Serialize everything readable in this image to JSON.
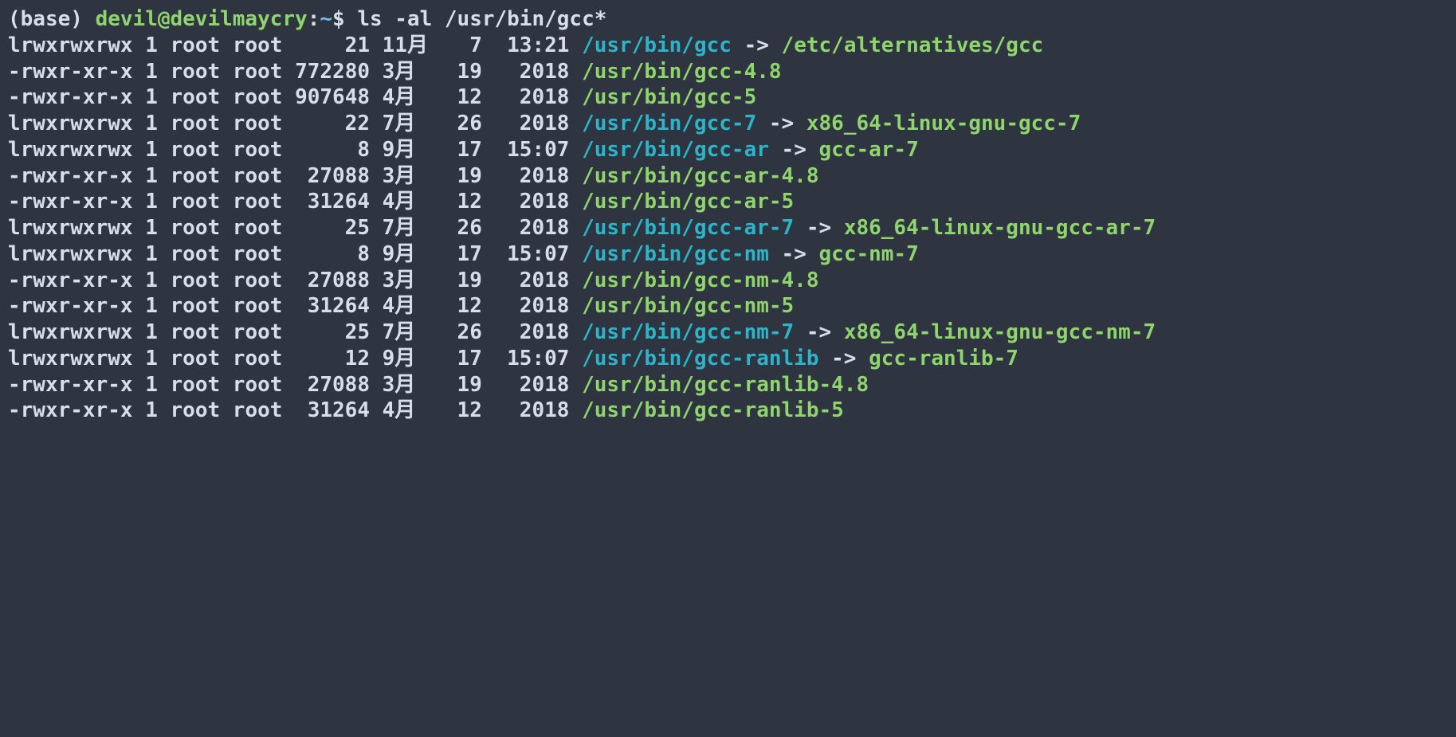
{
  "prompt": {
    "env": "(base) ",
    "user_host": "devil@devilmaycry",
    "colon": ":",
    "cwd": "~",
    "dollar": "$ ",
    "command": "ls -al /usr/bin/gcc*"
  },
  "rows": [
    {
      "perms": "lrwxrwxrwx",
      "n": "1",
      "owner": "root",
      "group": "root",
      "size": "21",
      "month": "11月",
      "day": "7",
      "time": "13:21",
      "name": "/usr/bin/gcc",
      "kind": "symlink",
      "arrow": " -> ",
      "target": "/etc/alternatives/gcc",
      "target_kind": "exec"
    },
    {
      "perms": "-rwxr-xr-x",
      "n": "1",
      "owner": "root",
      "group": "root",
      "size": "772280",
      "month": "3月",
      "day": "19",
      "time": "2018",
      "name": "/usr/bin/gcc-4.8",
      "kind": "exec"
    },
    {
      "perms": "-rwxr-xr-x",
      "n": "1",
      "owner": "root",
      "group": "root",
      "size": "907648",
      "month": "4月",
      "day": "12",
      "time": "2018",
      "name": "/usr/bin/gcc-5",
      "kind": "exec"
    },
    {
      "perms": "lrwxrwxrwx",
      "n": "1",
      "owner": "root",
      "group": "root",
      "size": "22",
      "month": "7月",
      "day": "26",
      "time": "2018",
      "name": "/usr/bin/gcc-7",
      "kind": "symlink",
      "arrow": " -> ",
      "target": "x86_64-linux-gnu-gcc-7",
      "target_kind": "exec"
    },
    {
      "perms": "lrwxrwxrwx",
      "n": "1",
      "owner": "root",
      "group": "root",
      "size": "8",
      "month": "9月",
      "day": "17",
      "time": "15:07",
      "name": "/usr/bin/gcc-ar",
      "kind": "symlink",
      "arrow": " -> ",
      "target": "gcc-ar-7",
      "target_kind": "exec"
    },
    {
      "perms": "-rwxr-xr-x",
      "n": "1",
      "owner": "root",
      "group": "root",
      "size": "27088",
      "month": "3月",
      "day": "19",
      "time": "2018",
      "name": "/usr/bin/gcc-ar-4.8",
      "kind": "exec"
    },
    {
      "perms": "-rwxr-xr-x",
      "n": "1",
      "owner": "root",
      "group": "root",
      "size": "31264",
      "month": "4月",
      "day": "12",
      "time": "2018",
      "name": "/usr/bin/gcc-ar-5",
      "kind": "exec"
    },
    {
      "perms": "lrwxrwxrwx",
      "n": "1",
      "owner": "root",
      "group": "root",
      "size": "25",
      "month": "7月",
      "day": "26",
      "time": "2018",
      "name": "/usr/bin/gcc-ar-7",
      "kind": "symlink",
      "arrow": " -> ",
      "target": "x86_64-linux-gnu-gcc-ar-7",
      "target_kind": "exec"
    },
    {
      "perms": "lrwxrwxrwx",
      "n": "1",
      "owner": "root",
      "group": "root",
      "size": "8",
      "month": "9月",
      "day": "17",
      "time": "15:07",
      "name": "/usr/bin/gcc-nm",
      "kind": "symlink",
      "arrow": " -> ",
      "target": "gcc-nm-7",
      "target_kind": "exec"
    },
    {
      "perms": "-rwxr-xr-x",
      "n": "1",
      "owner": "root",
      "group": "root",
      "size": "27088",
      "month": "3月",
      "day": "19",
      "time": "2018",
      "name": "/usr/bin/gcc-nm-4.8",
      "kind": "exec"
    },
    {
      "perms": "-rwxr-xr-x",
      "n": "1",
      "owner": "root",
      "group": "root",
      "size": "31264",
      "month": "4月",
      "day": "12",
      "time": "2018",
      "name": "/usr/bin/gcc-nm-5",
      "kind": "exec"
    },
    {
      "perms": "lrwxrwxrwx",
      "n": "1",
      "owner": "root",
      "group": "root",
      "size": "25",
      "month": "7月",
      "day": "26",
      "time": "2018",
      "name": "/usr/bin/gcc-nm-7",
      "kind": "symlink",
      "arrow": " -> ",
      "target": "x86_64-linux-gnu-gcc-nm-7",
      "target_kind": "exec"
    },
    {
      "perms": "lrwxrwxrwx",
      "n": "1",
      "owner": "root",
      "group": "root",
      "size": "12",
      "month": "9月",
      "day": "17",
      "time": "15:07",
      "name": "/usr/bin/gcc-ranlib",
      "kind": "symlink",
      "arrow": " -> ",
      "target": "gcc-ranlib-7",
      "target_kind": "exec"
    },
    {
      "perms": "-rwxr-xr-x",
      "n": "1",
      "owner": "root",
      "group": "root",
      "size": "27088",
      "month": "3月",
      "day": "19",
      "time": "2018",
      "name": "/usr/bin/gcc-ranlib-4.8",
      "kind": "exec"
    },
    {
      "perms": "-rwxr-xr-x",
      "n": "1",
      "owner": "root",
      "group": "root",
      "size": "31264",
      "month": "4月",
      "day": "12",
      "time": "2018",
      "name": "/usr/bin/gcc-ranlib-5",
      "kind": "exec"
    }
  ]
}
